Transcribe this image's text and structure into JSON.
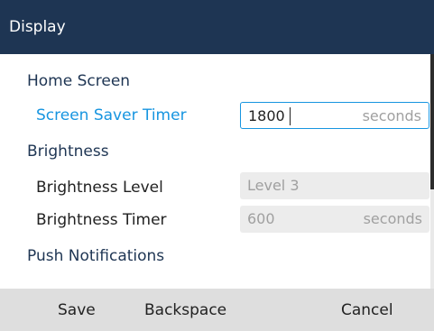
{
  "header": {
    "title": "Display"
  },
  "sections": {
    "home_screen": "Home Screen",
    "brightness": "Brightness",
    "push_notifications": "Push Notifications"
  },
  "settings": {
    "screen_saver_timer": {
      "label": "Screen Saver Timer",
      "value": "1800",
      "unit": "seconds"
    },
    "brightness_level": {
      "label": "Brightness Level",
      "value": "Level 3"
    },
    "brightness_timer": {
      "label": "Brightness Timer",
      "value": "600",
      "unit": "seconds"
    }
  },
  "softkeys": {
    "save": "Save",
    "backspace": "Backspace",
    "cancel": "Cancel"
  },
  "colors": {
    "title_bar": "#1e3553",
    "accent": "#1795e0",
    "softkey_bar": "#dedede"
  }
}
